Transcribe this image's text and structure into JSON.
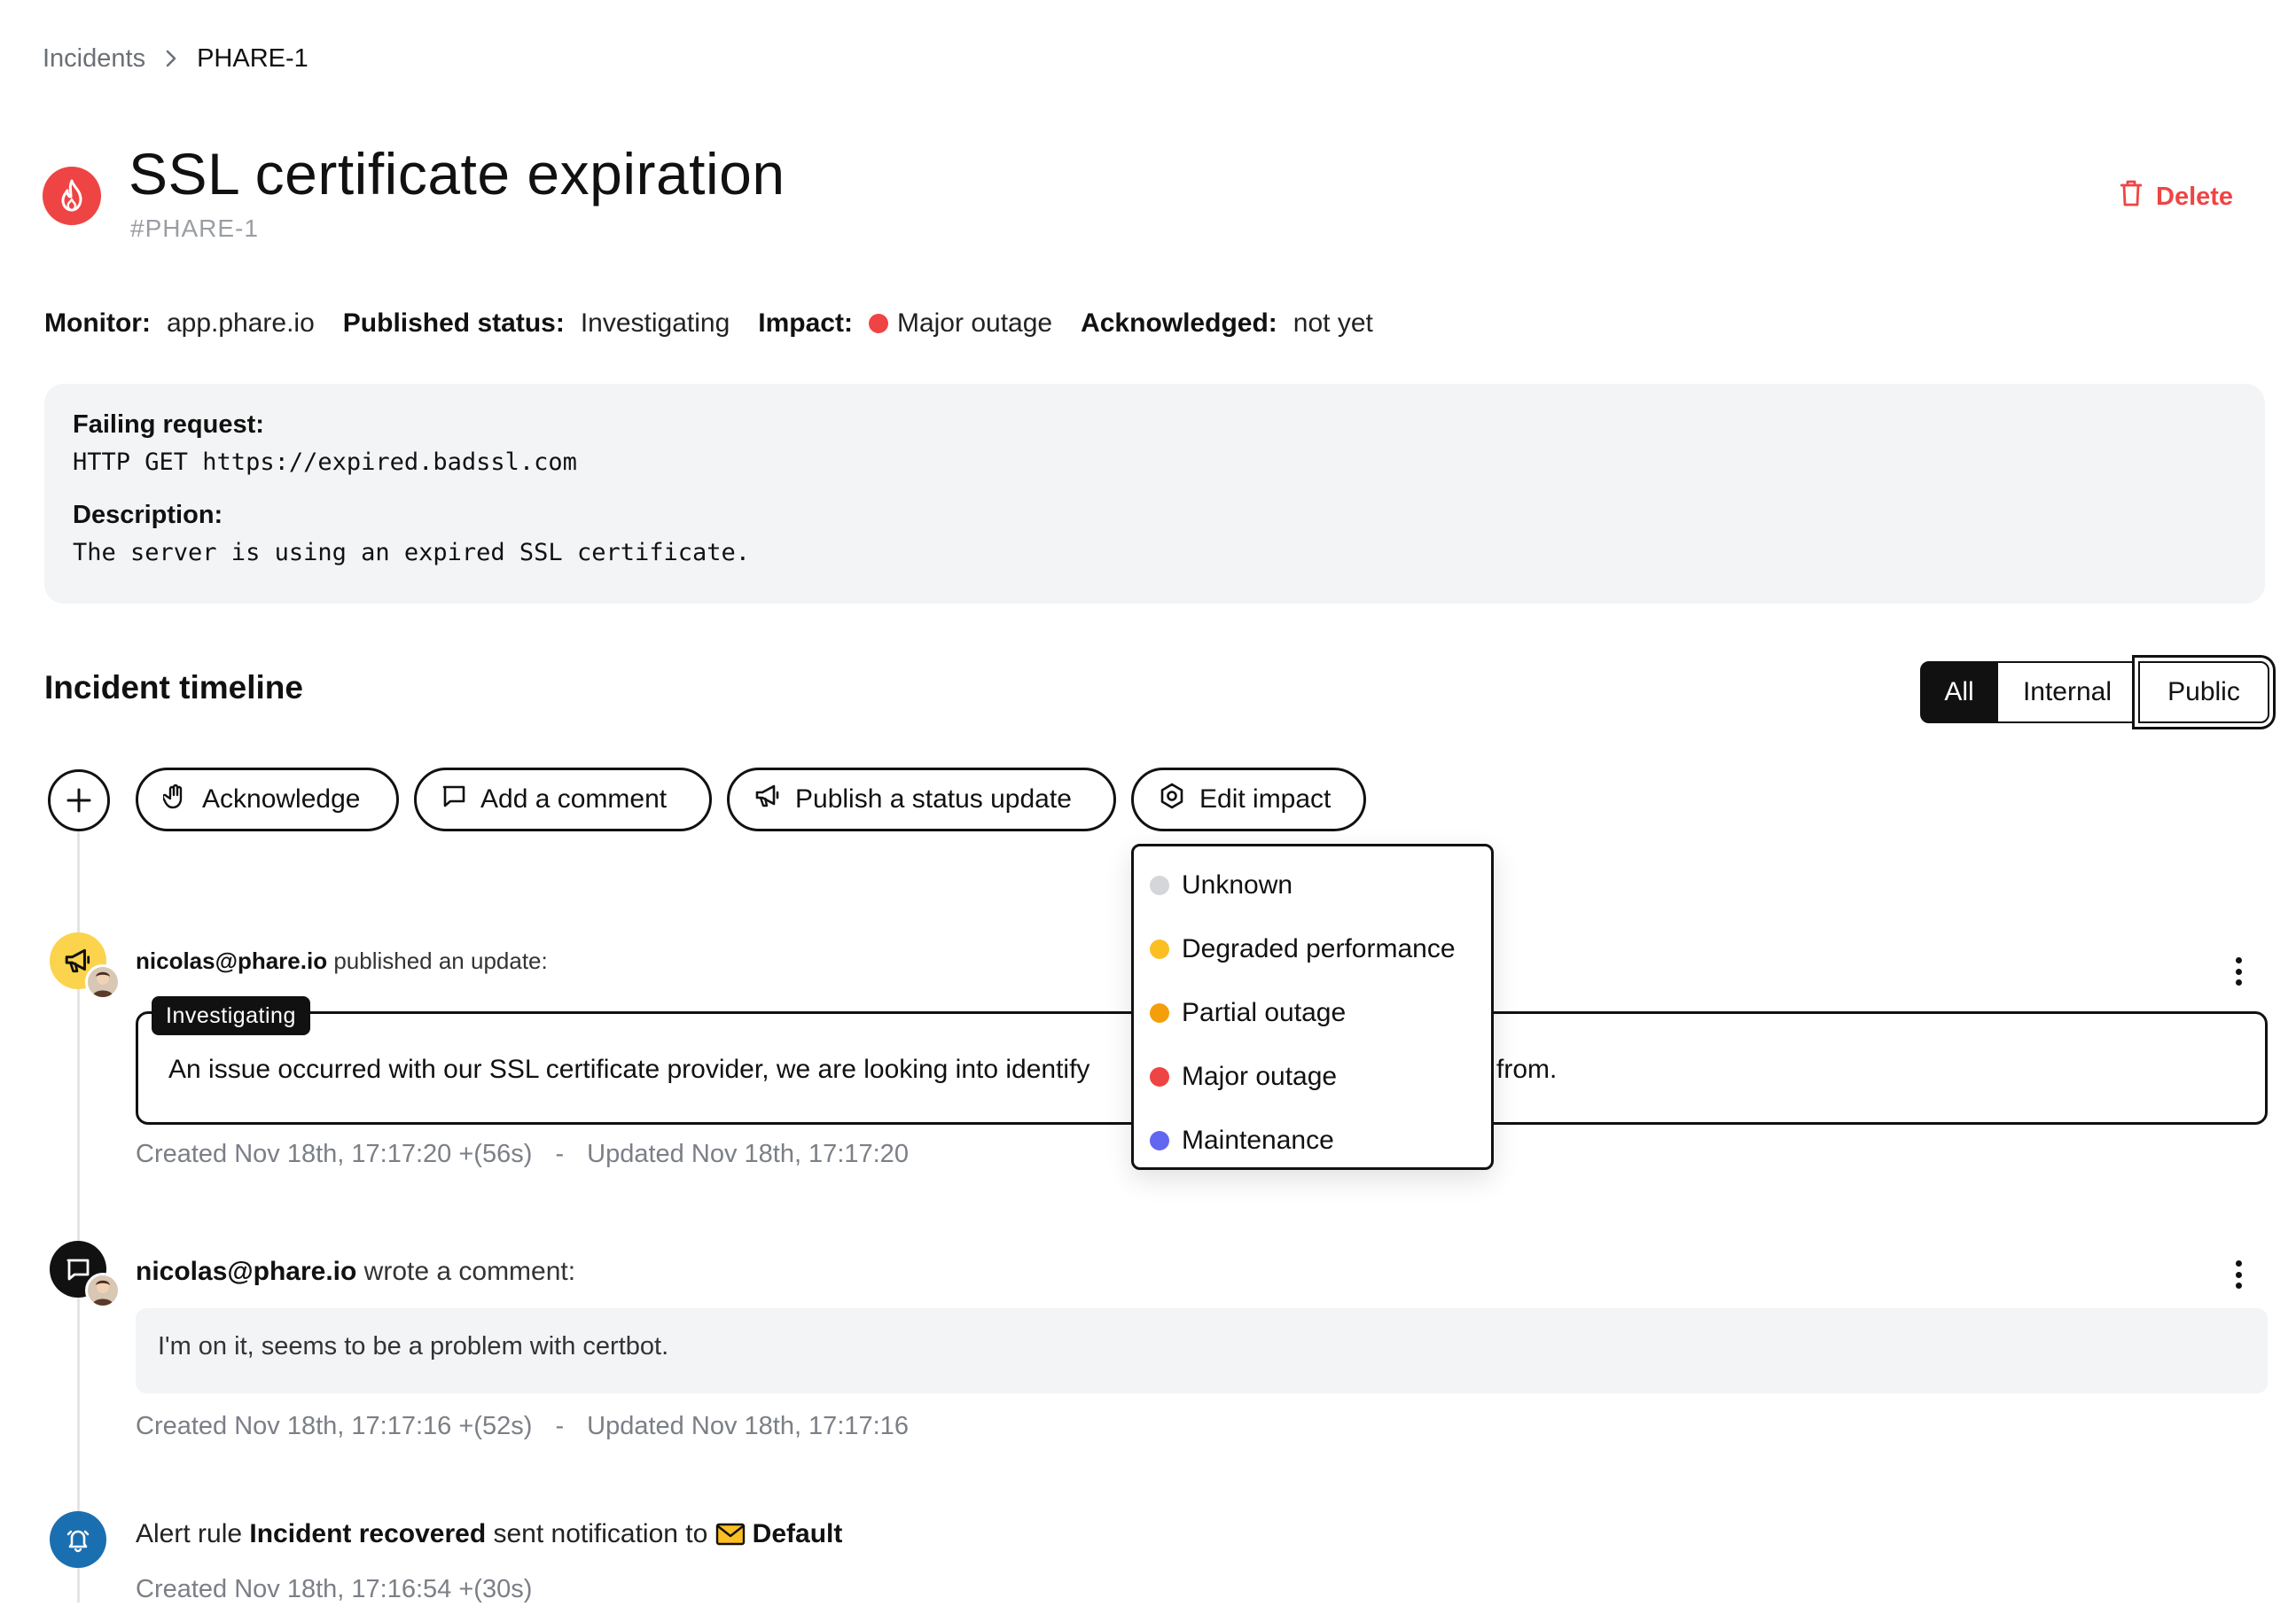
{
  "breadcrumb": {
    "parent": "Incidents",
    "current": "PHARE-1"
  },
  "incident": {
    "title": "SSL certificate expiration",
    "id": "#PHARE-1",
    "delete_label": "Delete",
    "icon": "flame-icon"
  },
  "meta": {
    "monitor_label": "Monitor:",
    "monitor_value": "app.phare.io",
    "published_label": "Published status:",
    "published_value": "Investigating",
    "impact_label": "Impact:",
    "impact_value": "Major outage",
    "impact_color": "#ef4444",
    "ack_label": "Acknowledged:",
    "ack_value": "not yet"
  },
  "details": {
    "failing_label": "Failing request:",
    "failing_value": "HTTP GET https://expired.badssl.com",
    "description_label": "Description:",
    "description_value": "The server is using an expired SSL certificate."
  },
  "timeline": {
    "title": "Incident timeline",
    "filters": [
      "All",
      "Internal",
      "Public"
    ],
    "selected_filter": "All"
  },
  "actions": {
    "acknowledge": "Acknowledge",
    "comment": "Add a comment",
    "publish": "Publish a status update",
    "edit_impact": "Edit impact"
  },
  "impact_menu": [
    {
      "label": "Unknown",
      "color": "#d4d6da"
    },
    {
      "label": "Degraded performance",
      "color": "#fbbf24"
    },
    {
      "label": "Partial outage",
      "color": "#f59e0b"
    },
    {
      "label": "Major outage",
      "color": "#ef4444"
    },
    {
      "label": "Maintenance",
      "color": "#6366f1"
    }
  ],
  "events": {
    "update": {
      "author": "nicolas@phare.io",
      "action": "published an update:",
      "status": "Investigating",
      "text_start": "An issue occurred with our SSL certificate provider, we are looking into identify",
      "text_end": "from.",
      "created": "Created Nov 18th, 17:17:20 +(56s)",
      "separator": "-",
      "updated": "Updated Nov 18th, 17:17:20"
    },
    "comment": {
      "author": "nicolas@phare.io",
      "action": "wrote a comment:",
      "text": "I'm on it, seems to be a problem with certbot.",
      "created": "Created Nov 18th, 17:17:16 +(52s)",
      "separator": "-",
      "updated": "Updated Nov 18th, 17:17:16"
    },
    "alert": {
      "prefix": "Alert rule",
      "rule": "Incident recovered",
      "middle": "sent notification to",
      "target": "Default",
      "created": "Created Nov 18th, 17:16:54 +(30s)"
    }
  }
}
